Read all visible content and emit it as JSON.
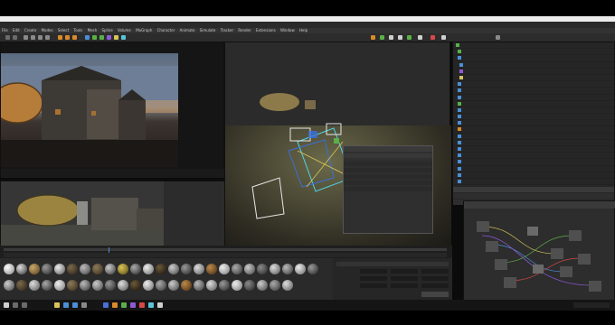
{
  "menu": {
    "items": [
      "File",
      "Edit",
      "Create",
      "Modes",
      "Select",
      "Tools",
      "Mesh",
      "Spline",
      "Volume",
      "MoGraph",
      "Character",
      "Animate",
      "Simulate",
      "Tracker",
      "Render",
      "Extensions",
      "Window",
      "Help"
    ]
  },
  "colors": {
    "accent_orange": "#d98a2b",
    "selection_blue": "#3a6fd8",
    "wire_white": "#e6e6e6",
    "wire_cyan": "#4fd6e8"
  },
  "icons": [
    "windows-start-icon",
    "search-icon",
    "task-view-icon",
    "folder-icon",
    "browser-icon",
    "mail-icon",
    "store-icon",
    "cinema4d-icon",
    "app-icon"
  ]
}
